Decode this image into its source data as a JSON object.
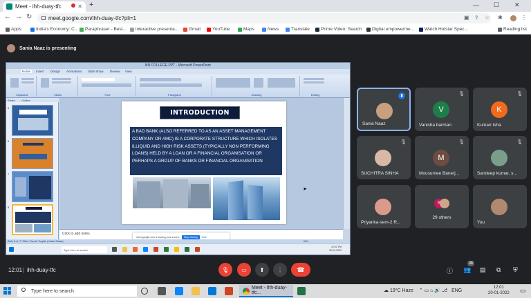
{
  "browser": {
    "tab_title": "Meet - ihh-duay-tfc",
    "url": "meet.google.com/ihh-duay-tfc?pli=1",
    "bookmarks": [
      "Apps",
      "India's Economy: C...",
      "Paraphraser - Best...",
      "interactive presenta...",
      "Gmail",
      "YouTube",
      "Maps",
      "News",
      "Translate",
      "Prime Video: Search",
      "Digital empowerme...",
      "Watch Hotstar Spec..."
    ],
    "reading_list": "Reading list"
  },
  "meet": {
    "presenter_label": "Sania Naaz is presenting",
    "time": "12:01",
    "meeting_code": "ihh-duay-tfc",
    "participants_count": "38",
    "participants": [
      {
        "name": "Sania Naaz",
        "initial": "",
        "color": "#c9a07f",
        "speaking": true
      },
      {
        "name": "Vanisha barman",
        "initial": "V",
        "color": "#1e7e4a",
        "speaking": false
      },
      {
        "name": "Kumari Isha",
        "initial": "K",
        "color": "#f26b1d",
        "speaking": false
      },
      {
        "name": "SUCHITRA SINHA",
        "initial": "",
        "color": "#d9b8a8",
        "speaking": false
      },
      {
        "name": "Mousumee Banerj...",
        "initial": "M",
        "color": "#6d4c41",
        "speaking": false
      },
      {
        "name": "Sandeep kumar, s...",
        "initial": "",
        "color": "#7a9e8a",
        "speaking": false
      },
      {
        "name": "Priyanka-sem-2 R...",
        "initial": "",
        "color": "#d99a8c",
        "speaking": false
      },
      {
        "name": "29 others",
        "initial": "S",
        "color": "#c2185b",
        "speaking": false
      },
      {
        "name": "You",
        "initial": "",
        "color": "#b08a6e",
        "speaking": false
      }
    ]
  },
  "ppt": {
    "window_title": "BN COLLEGE.PPT - Microsoft PowerPoint",
    "tabs": [
      "Home",
      "Insert",
      "Design",
      "Animations",
      "Slide Show",
      "Review",
      "View"
    ],
    "groups": [
      "Clipboard",
      "Slides",
      "Font",
      "Paragraph",
      "Drawing",
      "Editing"
    ],
    "left_tabs": [
      "Slides",
      "Outline"
    ],
    "slide_title": "INTRODUCTION",
    "slide_body": "A BAD BANK (ALSO REFERRED TO AS AN ASSET MANAGEMENT COMPANY OR AMC) IS A CORPORATE STRUCTURE WHICH ISOLATES ILLIQUID AND HIGH RISK ASSETS (TYPICALLY NON PERFORMING LOANS) HELD BY A LOAN OR A FINANCIAL ORGANISATION OR PERHAPS A GROUP OF BANKS OR FINANCIAL ORGANISATION",
    "notes_placeholder": "Click to add notes",
    "share_banner": "meet.google.com is sharing your screen.",
    "stop_sharing": "Stop sharing",
    "hide": "Hide",
    "status": "Slide 8 of 17   \"Office Theme\"   English (United States)",
    "zoom": "66%",
    "inner_search": "Type here to search",
    "inner_time": "12:01 PM",
    "inner_date": "20-01-2022"
  },
  "windows": {
    "search_placeholder": "Type here to search",
    "meet_task": "Meet - ihh-duay-tfc...",
    "weather": "19°C Haze",
    "lang": "ENG",
    "time": "12:01",
    "date": "20-01-2022"
  }
}
